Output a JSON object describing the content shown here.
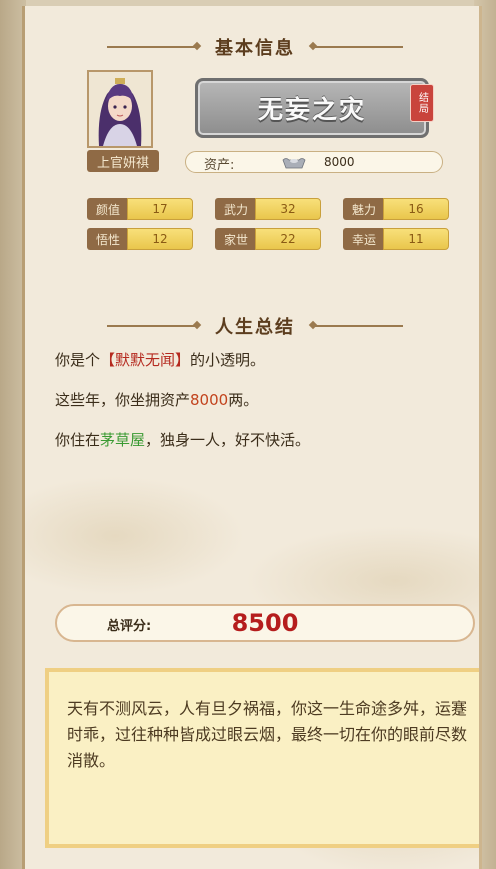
{
  "basic_info": {
    "section_title": "基本信息",
    "character_name": "上官妍祺",
    "title": "无妄之灾",
    "ending_badge": "结局",
    "assets_label": "资产:",
    "assets_icon": "silver-ingot-icon",
    "assets_value": "8000"
  },
  "stats": [
    {
      "label": "颜值",
      "value": "17"
    },
    {
      "label": "武力",
      "value": "32"
    },
    {
      "label": "魅力",
      "value": "16"
    },
    {
      "label": "悟性",
      "value": "12"
    },
    {
      "label": "家世",
      "value": "22"
    },
    {
      "label": "幸运",
      "value": "11"
    }
  ],
  "life_summary": {
    "section_title": "人生总结",
    "line1": {
      "pre": "你是个",
      "highlight": "【默默无闻】",
      "post": "的小透明。"
    },
    "line2": {
      "pre": "这些年，你坐拥资产",
      "highlight": "8000",
      "post": "两。"
    },
    "line3": {
      "pre": "你住在",
      "highlight": "茅草屋",
      "post": "，独身一人，好不快活。"
    }
  },
  "score": {
    "label": "总评分:",
    "value": "8500"
  },
  "verdict": {
    "text": "天有不测风云，人有旦夕祸福，你这一生命途多舛，运蹇时乖，过往种种皆成过眼云烟，最终一切在你的眼前尽数消散。"
  },
  "colors": {
    "accent_red": "#b52a1f",
    "accent_green": "#3a9a32",
    "stat_gold": "#f8e07a",
    "label_brown": "#8f6a45"
  }
}
